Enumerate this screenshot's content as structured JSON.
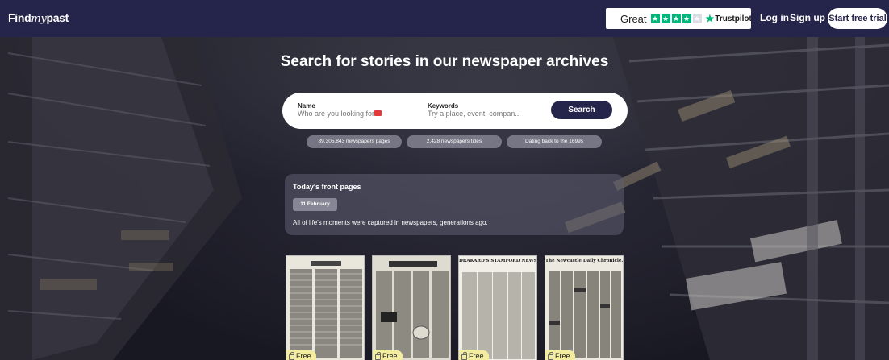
{
  "header": {
    "logo_text_1": "Find",
    "logo_text_2": "my",
    "logo_text_3": "past",
    "trustpilot_rating": "Great",
    "trustpilot_brand": "Trustpilot",
    "trustpilot_stars": 4.5,
    "login_label": "Log in",
    "signup_label": "Sign up",
    "trial_label": "Start free trial",
    "colors": {
      "nav_bg": "#25244a",
      "trustpilot_green": "#00b67a"
    }
  },
  "hero": {
    "title": "Search for stories in our newspaper archives"
  },
  "search": {
    "name_label": "Name",
    "name_placeholder": "Who are you looking for?",
    "keywords_label": "Keywords",
    "keywords_placeholder": "Try a place, event, compan...",
    "button_label": "Search"
  },
  "stats": [
    "89,305,843 newspapers pages",
    "2,428 newspapers titles",
    "Dating back to the 1699s"
  ],
  "front_pages": {
    "title": "Today's front pages",
    "date": "11 February",
    "description": "All of life's moments were captured in newspapers, generations ago.",
    "cards": [
      {
        "masthead": "",
        "badge": "Free"
      },
      {
        "masthead": "",
        "badge": "Free"
      },
      {
        "masthead": "DRAKARD'S STAMFORD NEWS.",
        "badge": "Free"
      },
      {
        "masthead": "The Newcastle Daily Chronicle.",
        "badge": "Free"
      }
    ]
  }
}
